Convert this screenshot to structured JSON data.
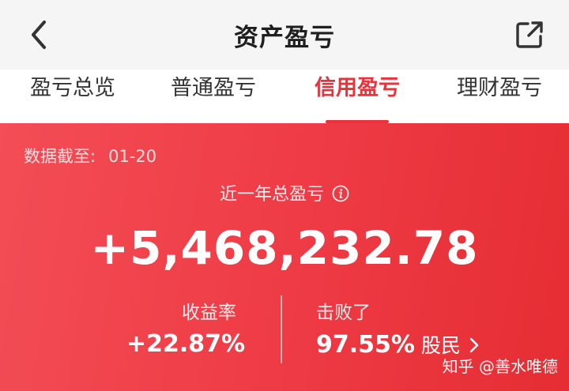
{
  "header": {
    "title": "资产盈亏",
    "back_icon": "chevron-left-icon",
    "share_icon": "external-link-icon"
  },
  "tabs": [
    {
      "label": "盈亏总览",
      "active": false
    },
    {
      "label": "普通盈亏",
      "active": false
    },
    {
      "label": "信用盈亏",
      "active": true
    },
    {
      "label": "理财盈亏",
      "active": false
    }
  ],
  "summary": {
    "as_of_label": "数据截至:",
    "as_of_date": "01-20",
    "period_label": "近一年总盈亏",
    "total_pnl": "+5,468,232.78",
    "return_label": "收益率",
    "return_value": "+22.87%",
    "beat_label": "击败了",
    "beat_value": "97.55%",
    "beat_suffix": "股民"
  },
  "watermark": "知乎 @善水唯德",
  "colors": {
    "accent": "#e8323c",
    "panel_start": "#f34d56",
    "panel_end": "#e52d33"
  }
}
